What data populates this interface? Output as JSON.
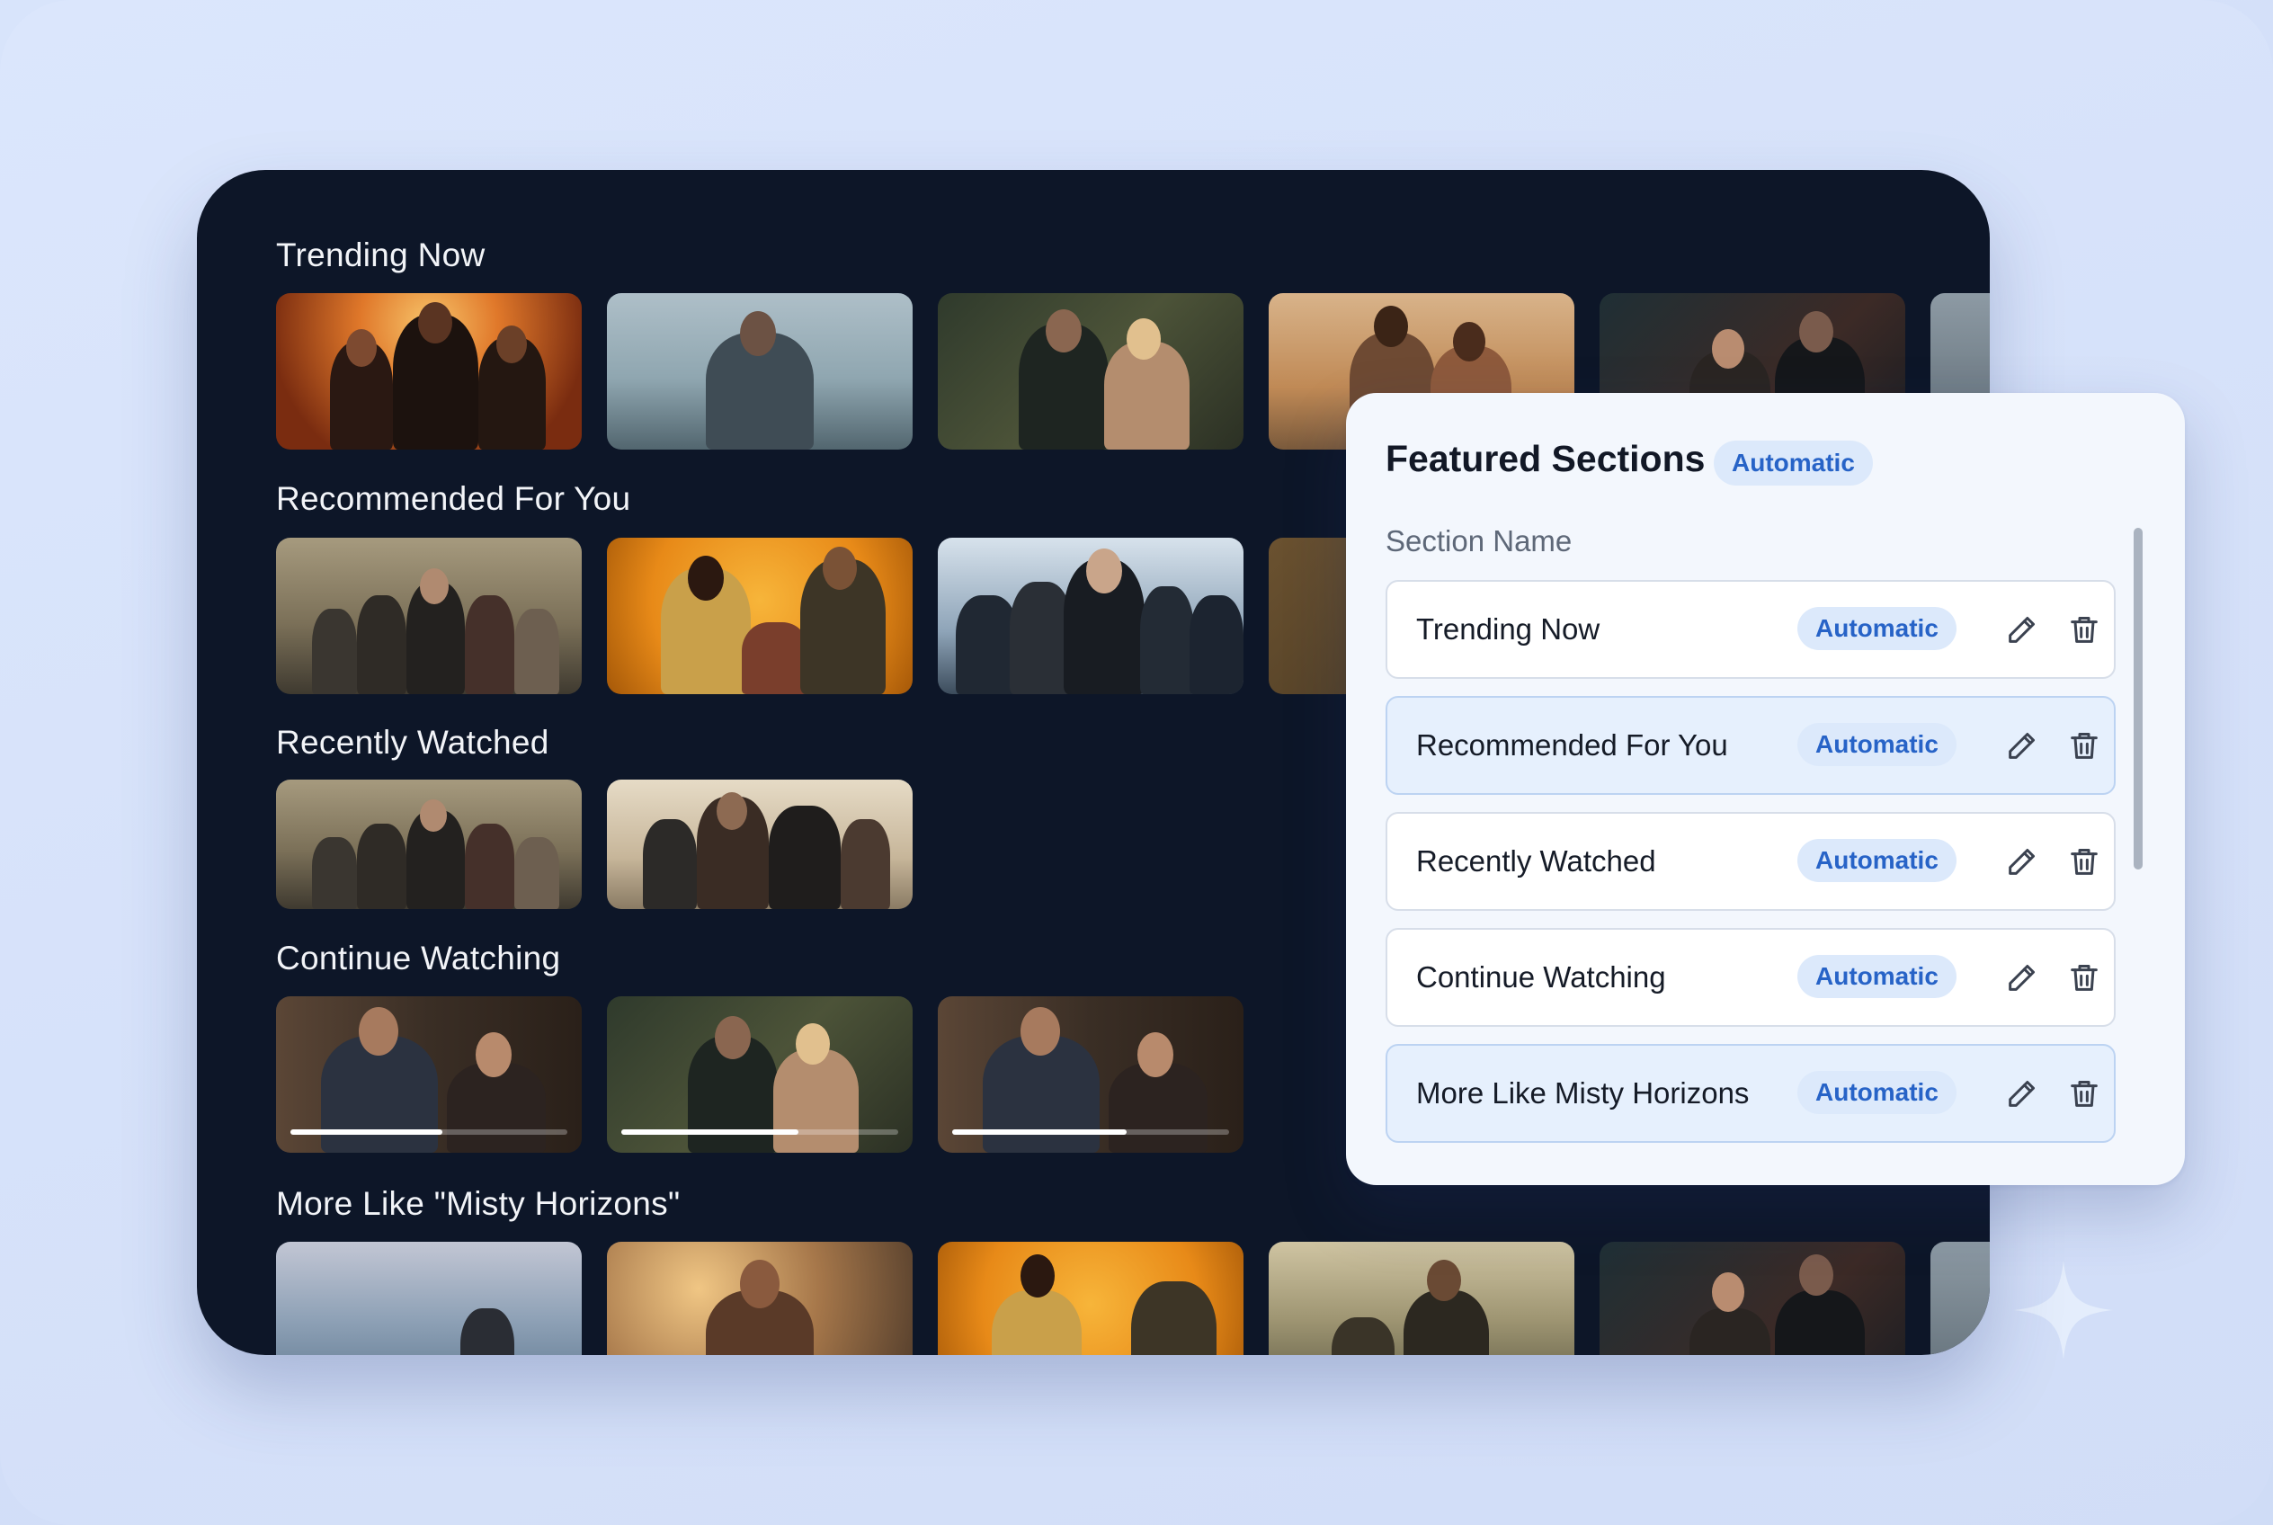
{
  "stream": {
    "rows": [
      {
        "title": "Trending Now"
      },
      {
        "title": "Recommended For You"
      },
      {
        "title": "Recently Watched"
      },
      {
        "title": "Continue Watching",
        "progress": [
          0.55,
          0.64,
          0.63
        ]
      },
      {
        "title": "More Like \"Misty Horizons\""
      }
    ]
  },
  "panel": {
    "title": "Featured Sections",
    "title_badge": "Automatic",
    "column_label": "Section Name",
    "items": [
      {
        "name": "Trending Now",
        "badge": "Automatic"
      },
      {
        "name": "Recommended For You",
        "badge": "Automatic"
      },
      {
        "name": "Recently Watched",
        "badge": "Automatic"
      },
      {
        "name": "Continue Watching",
        "badge": "Automatic"
      },
      {
        "name": "More Like Misty Horizons",
        "badge": "Automatic"
      }
    ]
  },
  "colors": {
    "accent": "#2763c7",
    "badge_bg": "#dce9fb",
    "panel_bg": "#0d1628"
  },
  "icons": [
    "pencil-icon",
    "trash-icon",
    "sparkle-icon"
  ]
}
